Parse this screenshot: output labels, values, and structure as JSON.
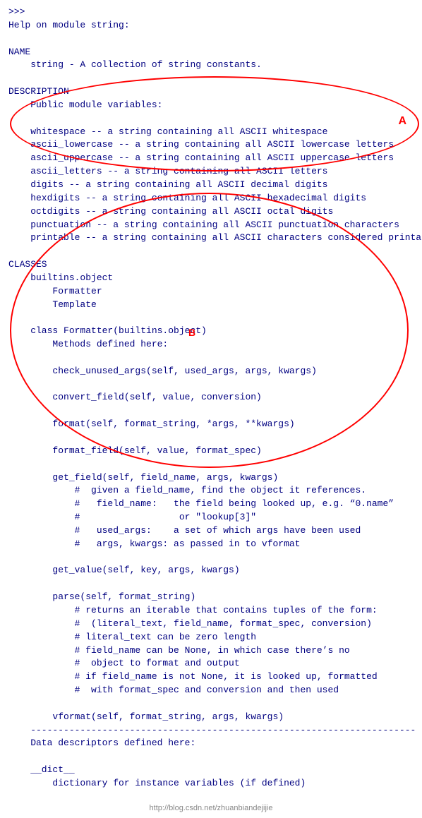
{
  "header": {
    "prompt": ">>>",
    "title": "Help on module string:"
  },
  "sections": {
    "name": {
      "label": "NAME",
      "content": "    string - A collection of string constants."
    },
    "description": {
      "label": "DESCRIPTION",
      "intro": "    Public module variables:",
      "variables": [
        "    whitespace -- a string containing all ASCII whitespace",
        "    ascii_lowercase -- a string containing all ASCII lowercase letters",
        "    ascii_uppercase -- a string containing all ASCII uppercase letters",
        "    ascii_letters -- a string containing all ASCII letters",
        "    digits -- a string containing all ASCII decimal digits",
        "    hexdigits -- a string containing all ASCII hexadecimal digits",
        "    octdigits -- a string containing all ASCII octal digits",
        "    punctuation -- a string containing all ASCII punctuation characters",
        "    printable -- a string containing all ASCII characters considered printable"
      ]
    },
    "classes": {
      "label": "CLASSES",
      "builtins": "    builtins.object",
      "class_list": [
        "        Formatter",
        "        Template"
      ],
      "formatter_class": "    class Formatter(builtins.object)",
      "methods_header": "        Methods defined here:",
      "methods": [
        "        check_unused_args(self, used_args, args, kwargs)",
        "        convert_field(self, value, conversion)",
        "        format(self, format_string, *args, **kwargs)",
        "        format_field(self, value, format_spec)",
        "        get_field(self, field_name, args, kwargs)",
        "            #  given a field_name, find the object it references.",
        "            #   field_name:   the field being looked up, e.g. “0.name”",
        "            #                  or \"lookup[3]\"",
        "            #   used_args:    a set of which args have been used",
        "            #   args, kwargs: as passed in to vformat",
        "        get_value(self, key, args, kwargs)",
        "        parse(self, format_string)",
        "            # returns an iterable that contains tuples of the form:",
        "            #  (literal_text, field_name, format_spec, conversion)",
        "            # literal_text can be zero length",
        "            # field_name can be None, in which case there’s no",
        "            #  object to format and output",
        "            # if field_name is not None, it is looked up, formatted",
        "            #  with format_spec and conversion and then used",
        "        vformat(self, format_string, args, kwargs)"
      ],
      "separator": "    ----------------------------------------------------------------------",
      "data_descriptors": "    Data descriptors defined here:",
      "dict_entry": "    __dict__",
      "dict_desc": "        dictionary for instance variables (if defined)"
    }
  },
  "watermark": "http://blog.csdn.net/zhuanbiandejijie",
  "annotations": {
    "a_label": "A",
    "b_label": "B"
  }
}
